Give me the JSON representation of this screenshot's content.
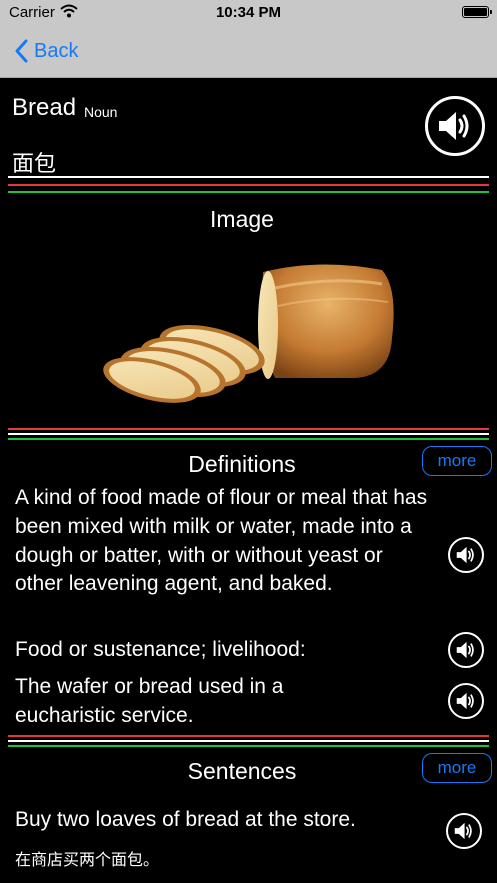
{
  "status_bar": {
    "carrier": "Carrier",
    "time": "10:34 PM"
  },
  "nav": {
    "back_label": "Back"
  },
  "entry": {
    "word": "Bread",
    "part_of_speech": "Noun",
    "translation": "面包"
  },
  "image_section": {
    "title": "Image"
  },
  "definitions": {
    "title": "Definitions",
    "more_label": "more",
    "items": [
      {
        "text": "A kind of food made of flour or meal that has been mixed with milk or water, made into a dough or batter, with or without yeast or other leavening agent, and baked."
      },
      {
        "text": "Food or sustenance; livelihood:"
      },
      {
        "text": "The wafer or bread used in a eucharistic service."
      }
    ]
  },
  "sentences": {
    "title": "Sentences",
    "more_label": "more",
    "items": [
      {
        "text": "Buy two loaves of bread at the store.",
        "translation": "在商店买两个面包。"
      }
    ]
  },
  "icons": {
    "back": "chevron-left-icon",
    "main_audio": "speaker-icon",
    "wifi": "wifi-icon",
    "battery": "battery-icon"
  },
  "colors": {
    "accent": "#1679f5",
    "rule_red": "#e03a3a",
    "rule_green": "#1ec23e",
    "background": "#000000",
    "navbar": "#c8c8c8"
  }
}
